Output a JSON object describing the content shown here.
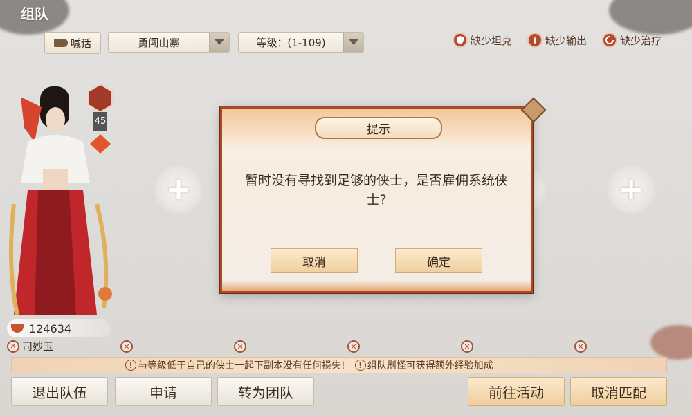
{
  "header": {
    "title": "组队"
  },
  "toolbar": {
    "shout_label": "喊话",
    "dungeon_select": "勇闯山寨",
    "level_select": "等级：(1-109)"
  },
  "lack_roles": [
    {
      "label": "缺少坦克",
      "icon": "shield-icon"
    },
    {
      "label": "缺少输出",
      "icon": "sword-icon"
    },
    {
      "label": "缺少治疗",
      "icon": "heal-icon"
    }
  ],
  "member": {
    "level": "45",
    "power": "124634",
    "name": "司妙玉"
  },
  "notice": {
    "left": "与等级低于自己的侠士一起下副本没有任何损失!",
    "right": "组队刷怪可获得额外经验加成"
  },
  "buttons": {
    "leave": "退出队伍",
    "apply": "申请",
    "convert": "转为团队",
    "goto": "前往活动",
    "cancel_match": "取消匹配"
  },
  "dialog": {
    "title": "提示",
    "message": "暂时没有寻找到足够的侠士，是否雇佣系统侠士?",
    "cancel": "取消",
    "confirm": "确定"
  },
  "colors": {
    "accent": "#a84a2a",
    "gold_button": "#efcf9f",
    "notice_bar": "#f7e2c9"
  }
}
